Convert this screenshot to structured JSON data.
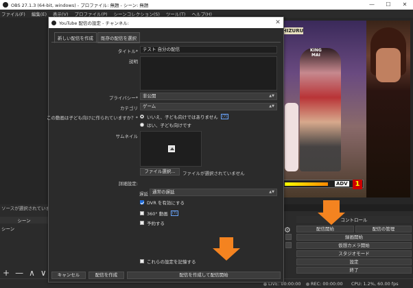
{
  "obs": {
    "title": "OBS 27.1.3 (64-bit, windows) - プロファイル: 無題 - シーン: 無題",
    "win_min": "—",
    "win_max": "☐",
    "win_close": "✕",
    "menu": [
      "ファイル(F)",
      "編集(E)",
      "表示(V)",
      "プロファイル(P)",
      "シーンコレクション(S)",
      "ツール(T)",
      "ヘルプ(H)"
    ]
  },
  "game": {
    "name_plate": "HIZURU",
    "king_label": "KING\nMAI",
    "adv_label": "ADV",
    "adv_number": "1",
    "power_fill": 0.55
  },
  "scenes": {
    "no_source": "ソースが選択されていません",
    "header": "シーン",
    "item": "シーン",
    "add": "+",
    "remove": "—",
    "up": "∧",
    "down": "∨"
  },
  "controls": {
    "title": "コントロール",
    "start_streaming": "配信開始",
    "manage_broadcast": "配信の管理",
    "start_recording": "録画開始",
    "virtual_camera": "仮想カメラ開始",
    "studio_mode": "スタジオモード",
    "settings": "設定",
    "exit": "終了"
  },
  "status": {
    "live": "LIVE: 00:00:00",
    "rec": "REC: 00:00:00",
    "cpu": "CPU: 1.2%, 60.00 fps"
  },
  "dialog": {
    "title": "YouTube 配信の設定 - チャンネル:",
    "close": "✕",
    "tabs": [
      "新しい配信を作成",
      "既存の配信を選択"
    ],
    "title_label": "タイトル*",
    "title_value": "テスト 自分の配信",
    "description_label": "説明",
    "privacy_label": "プライバシー*",
    "privacy_value": "非公開",
    "category_label": "カテゴリ",
    "category_value": "ゲーム",
    "kids_question": "この動画は子ども向けに作られていますか？*",
    "kids_no": "いいえ、子ども向けではありません",
    "kids_yes": "はい、子ども向けです",
    "help": "(?)",
    "thumbnail_label": "サムネイル",
    "file_select": "ファイル選択...",
    "no_file": "ファイルが選択されていません",
    "advanced_label": "詳細設定:",
    "latency_label": "遅延",
    "latency_value": "通常の遅延",
    "dvr": "DVR を有効にする",
    "video360": "360° 動画",
    "schedule": "予約する",
    "remember": "これらの設定を記憶する",
    "cancel": "キャンセル",
    "create": "配信を作成",
    "create_start": "配信を作成して配信開始"
  },
  "arrow_color": "#f48320"
}
